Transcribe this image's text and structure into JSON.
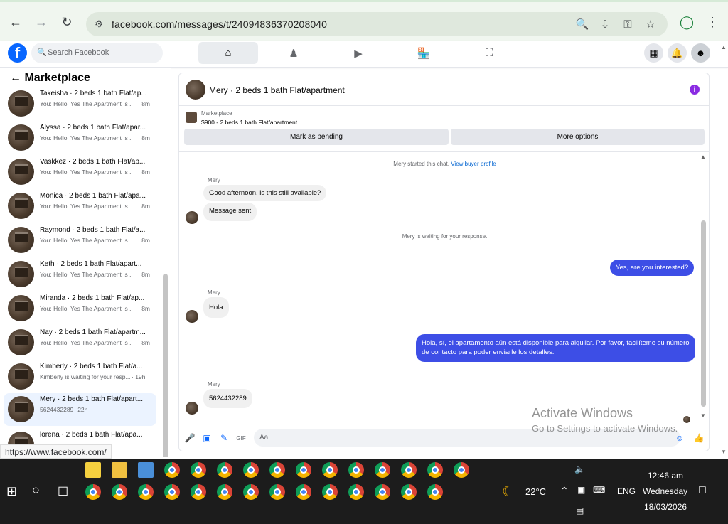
{
  "browser": {
    "url": "facebook.com/messages/t/24094836370208040",
    "status_url": "https://www.facebook.com/"
  },
  "fb": {
    "search_placeholder": "Search Facebook",
    "logo": "f"
  },
  "sidebar": {
    "heading": "Marketplace",
    "items": [
      {
        "name": "Takeisha · 2 beds 1 bath Flat/ap...",
        "preview": "You: Hello: Yes The Apartment Is ...",
        "time": "· 8m"
      },
      {
        "name": "Alyssa · 2 beds 1 bath Flat/apar...",
        "preview": "You: Hello: Yes The Apartment Is ...",
        "time": "· 8m"
      },
      {
        "name": "Vaskkez · 2 beds 1 bath Flat/ap...",
        "preview": "You: Hello: Yes The Apartment Is ...",
        "time": "· 8m"
      },
      {
        "name": "Monica · 2 beds 1 bath Flat/apa...",
        "preview": "You: Hello: Yes The Apartment Is ...",
        "time": "· 8m"
      },
      {
        "name": "Raymond · 2 beds 1 bath Flat/a...",
        "preview": "You: Hello: Yes The Apartment Is ...",
        "time": "· 8m"
      },
      {
        "name": "Keth · 2 beds 1 bath Flat/apart...",
        "preview": "You: Hello: Yes The Apartment Is ...",
        "time": "· 8m"
      },
      {
        "name": "Miranda · 2 beds 1 bath Flat/ap...",
        "preview": "You: Hello: Yes The Apartment Is ...",
        "time": "· 8m"
      },
      {
        "name": "Nay · 2 beds 1 bath Flat/apartm...",
        "preview": "You: Hello: Yes The Apartment Is ...",
        "time": "· 8m"
      },
      {
        "name": "Kimberly · 2 beds 1 bath Flat/a...",
        "preview": "Kimberly is waiting for your resp...",
        "time": "· 19h"
      },
      {
        "name": "Mery · 2 beds 1 bath Flat/apart...",
        "preview": "5624432289",
        "time": "· 22h"
      },
      {
        "name": "lorena · 2 beds 1 bath Flat/apa...",
        "preview": "",
        "time": ""
      }
    ]
  },
  "chat": {
    "title": "Mery · 2 beds 1 bath Flat/apartment",
    "marketplace_label": "Marketplace",
    "listing": "$900 - 2 beds 1 bath Flat/apartment",
    "btn_pending": "Mark as pending",
    "btn_more": "More options",
    "started_text": "Mery started this chat.",
    "view_profile": "View buyer profile",
    "waiting_text": "Mery is waiting for your response.",
    "sender": "Mery",
    "messages": {
      "m1": "Good afternoon, is this still available?",
      "m2": "Message sent",
      "m3": "Yes, are you interested?",
      "m4": "Hola",
      "m5": "Hola, sí, el apartamento aún está disponible para alquilar. Por favor, facilíteme su número de contacto para poder enviarle los detalles.",
      "m6": "5624432289"
    },
    "input_placeholder": "Aa"
  },
  "watermark": {
    "line1": "Activate Windows",
    "line2": "Go to Settings to activate Windows."
  },
  "taskbar": {
    "weather": "22°C",
    "lang": "ENG",
    "time": "12:46 am",
    "day": "Wednesday",
    "date": "18/03/2026"
  }
}
